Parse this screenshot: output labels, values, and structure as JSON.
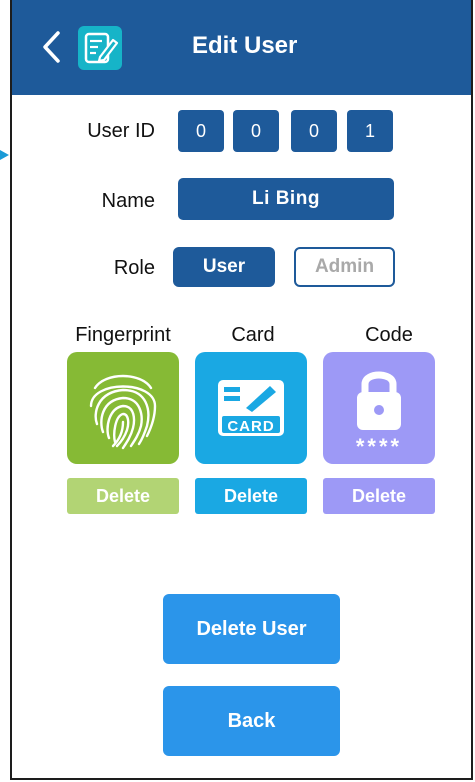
{
  "header": {
    "title": "Edit User",
    "back_icon": "chevron-left-icon",
    "edit_icon": "edit-note-icon"
  },
  "form": {
    "user_id_label": "User ID",
    "user_id_digits": [
      "0",
      "0",
      "0",
      "1"
    ],
    "name_label": "Name",
    "name_value": "Li Bing",
    "role_label": "Role",
    "role_options": [
      "User",
      "Admin"
    ],
    "role_selected": "User"
  },
  "credentials": [
    {
      "label": "Fingerprint",
      "icon": "fingerprint-icon",
      "delete_label": "Delete",
      "color": "#86ba35",
      "delete_color": "#b2d474"
    },
    {
      "label": "Card",
      "icon": "card-icon",
      "icon_text": "CARD",
      "delete_label": "Delete",
      "color": "#1aa8e3",
      "delete_color": "#1aa8e3"
    },
    {
      "label": "Code",
      "icon": "lock-icon",
      "icon_text": "****",
      "delete_label": "Delete",
      "color": "#9d99f6",
      "delete_color": "#9d99f6"
    }
  ],
  "actions": {
    "delete_user_label": "Delete User",
    "back_label": "Back"
  },
  "colors": {
    "header_bg": "#1e5a9a",
    "primary": "#1e5a9a",
    "button_blue": "#2b95ea"
  }
}
